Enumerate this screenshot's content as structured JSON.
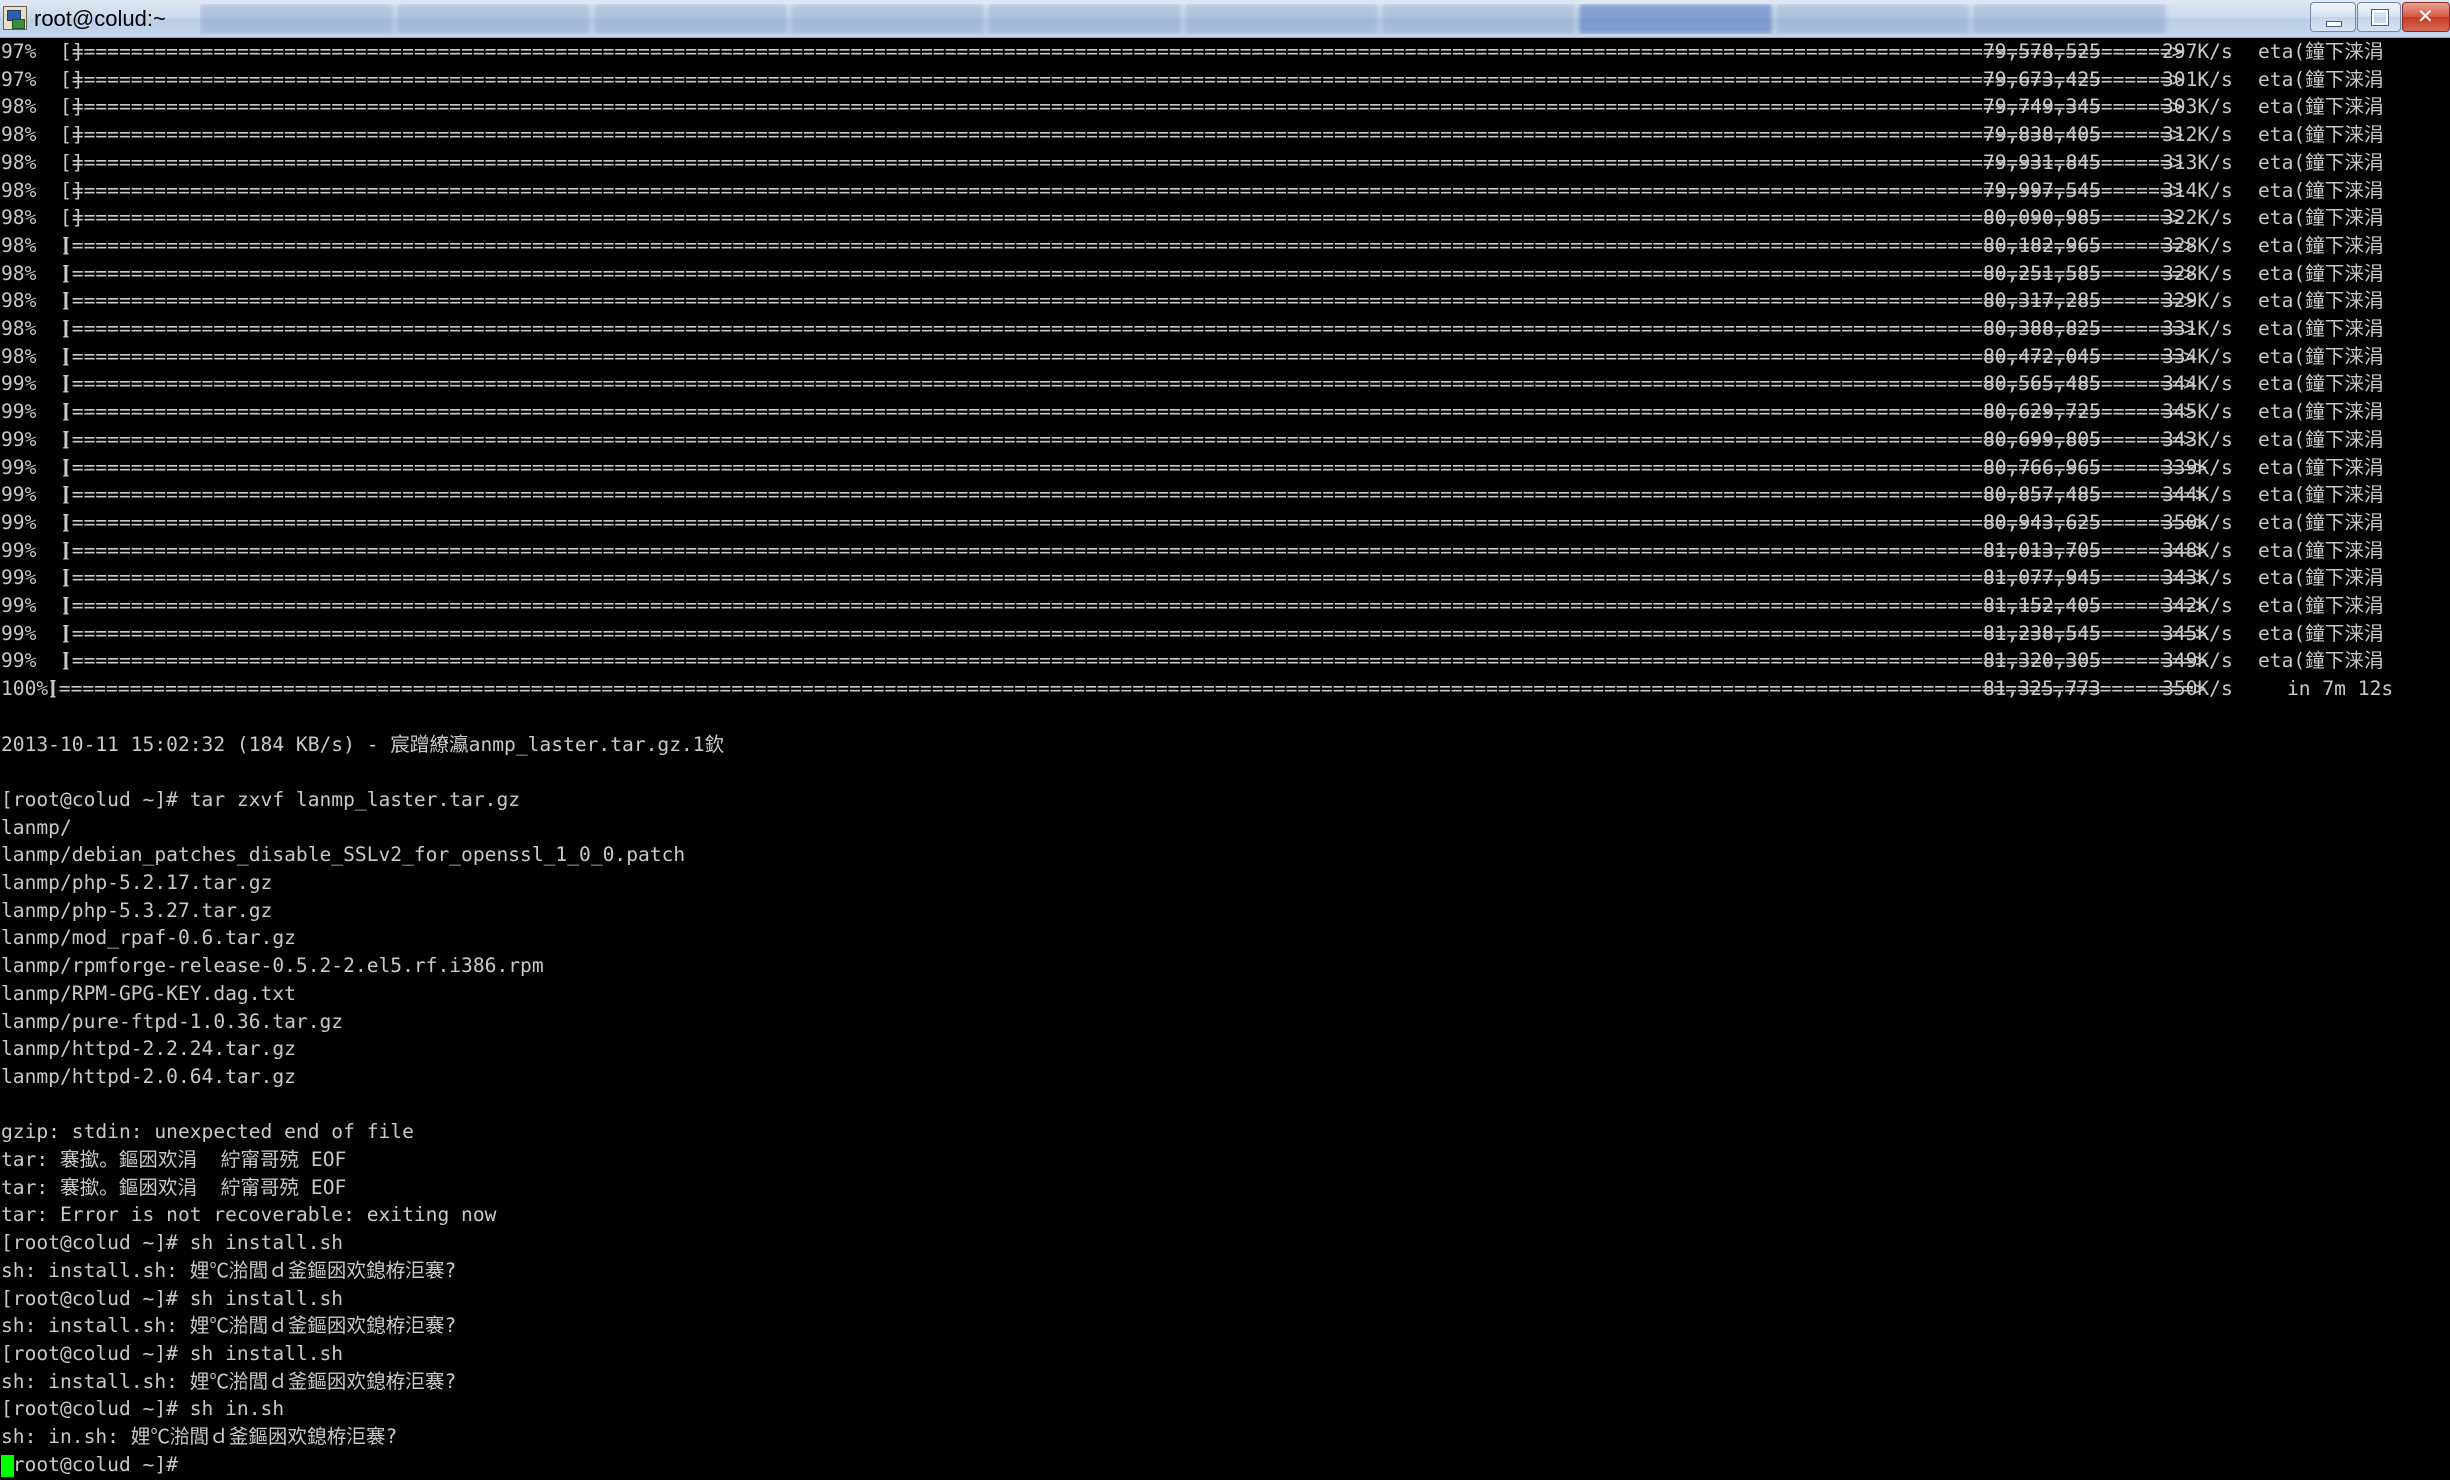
{
  "window": {
    "title": "root@colud:~",
    "icon": "putty-terminal-icon",
    "buttons": [
      "minimize",
      "maximize",
      "close"
    ]
  },
  "colors": {
    "background": "#000000",
    "text": "#c9c9c9",
    "cursor": "#00ff00",
    "titlebar": "#c9d9ec"
  },
  "terminal": {
    "progress_rows": [
      {
        "pct": "97%",
        "bar": "[==================================================================================================================================================================================>",
        "close": " ]",
        "bytes": "79,578,525",
        "speed": "297K/s",
        "eta": "eta(鐘下涞涓"
      },
      {
        "pct": "97%",
        "bar": "[==================================================================================================================================================================================>",
        "close": " ]",
        "bytes": "79,673,425",
        "speed": "301K/s",
        "eta": "eta(鐘下涞涓"
      },
      {
        "pct": "98%",
        "bar": "[==================================================================================================================================================================================>",
        "close": " ]",
        "bytes": "79,749,345",
        "speed": "303K/s",
        "eta": "eta(鐘下涞涓"
      },
      {
        "pct": "98%",
        "bar": "[==================================================================================================================================================================================>",
        "close": " ]",
        "bytes": "79,838,405",
        "speed": "312K/s",
        "eta": "eta(鐘下涞涓"
      },
      {
        "pct": "98%",
        "bar": "[==================================================================================================================================================================================>",
        "close": " ]",
        "bytes": "79,931,845",
        "speed": "313K/s",
        "eta": "eta(鐘下涞涓"
      },
      {
        "pct": "98%",
        "bar": "[==================================================================================================================================================================================>",
        "close": " ]",
        "bytes": "79,997,545",
        "speed": "314K/s",
        "eta": "eta(鐘下涞涓"
      },
      {
        "pct": "98%",
        "bar": "[==================================================================================================================================================================================>",
        "close": " ]",
        "bytes": "80,090,985",
        "speed": "322K/s",
        "eta": "eta(鐘下涞涓"
      },
      {
        "pct": "98%",
        "bar": "[===================================================================================================================================================================================>",
        "close": "]",
        "bytes": "80,182,965",
        "speed": "328K/s",
        "eta": "eta(鐘下涞涓"
      },
      {
        "pct": "98%",
        "bar": "[===================================================================================================================================================================================>",
        "close": "]",
        "bytes": "80,251,585",
        "speed": "328K/s",
        "eta": "eta(鐘下涞涓"
      },
      {
        "pct": "98%",
        "bar": "[===================================================================================================================================================================================>",
        "close": "]",
        "bytes": "80,317,285",
        "speed": "329K/s",
        "eta": "eta(鐘下涞涓"
      },
      {
        "pct": "98%",
        "bar": "[===================================================================================================================================================================================>",
        "close": "]",
        "bytes": "80,388,825",
        "speed": "331K/s",
        "eta": "eta(鐘下涞涓"
      },
      {
        "pct": "98%",
        "bar": "[===================================================================================================================================================================================>",
        "close": "]",
        "bytes": "80,472,045",
        "speed": "334K/s",
        "eta": "eta(鐘下涞涓"
      },
      {
        "pct": "99%",
        "bar": "[===================================================================================================================================================================================>",
        "close": "]",
        "bytes": "80,565,485",
        "speed": "344K/s",
        "eta": "eta(鐘下涞涓"
      },
      {
        "pct": "99%",
        "bar": "[===================================================================================================================================================================================>",
        "close": "]",
        "bytes": "80,629,725",
        "speed": "345K/s",
        "eta": "eta(鐘下涞涓"
      },
      {
        "pct": "99%",
        "bar": "[===================================================================================================================================================================================>",
        "close": "]",
        "bytes": "80,699,805",
        "speed": "343K/s",
        "eta": "eta(鐘下涞涓"
      },
      {
        "pct": "99%",
        "bar": "[====================================================================================================================================================================================>",
        "close": "]",
        "bytes": "80,766,965",
        "speed": "339K/s",
        "eta": "eta(鐘下涞涓"
      },
      {
        "pct": "99%",
        "bar": "[====================================================================================================================================================================================>",
        "close": "]",
        "bytes": "80,857,485",
        "speed": "344K/s",
        "eta": "eta(鐘下涞涓"
      },
      {
        "pct": "99%",
        "bar": "[====================================================================================================================================================================================>",
        "close": "]",
        "bytes": "80,943,625",
        "speed": "350K/s",
        "eta": "eta(鐘下涞涓"
      },
      {
        "pct": "99%",
        "bar": "[====================================================================================================================================================================================>",
        "close": "]",
        "bytes": "81,013,705",
        "speed": "348K/s",
        "eta": "eta(鐘下涞涓"
      },
      {
        "pct": "99%",
        "bar": "[====================================================================================================================================================================================>",
        "close": "]",
        "bytes": "81,077,945",
        "speed": "343K/s",
        "eta": "eta(鐘下涞涓"
      },
      {
        "pct": "99%",
        "bar": "[====================================================================================================================================================================================>",
        "close": "]",
        "bytes": "81,152,405",
        "speed": "342K/s",
        "eta": "eta(鐘下涞涓"
      },
      {
        "pct": "99%",
        "bar": "[====================================================================================================================================================================================>",
        "close": "]",
        "bytes": "81,238,545",
        "speed": "345K/s",
        "eta": "eta(鐘下涞涓"
      },
      {
        "pct": "99%",
        "bar": "[====================================================================================================================================================================================>",
        "close": "]",
        "bytes": "81,320,305",
        "speed": "349K/s",
        "eta": "eta(鐘下涞涓"
      },
      {
        "pct": "100%",
        "bar": "[=====================================================================================================================================================================================>",
        "close": "]",
        "bytes": "81,325,773",
        "speed": "350K/s",
        "eta": "in 7m 12s"
      }
    ],
    "lines": [
      "",
      "2013-10-11 15:02:32 (184 KB/s) - 宸蹭繚瀛anmp_laster.tar.gz.1欽",
      "",
      "[root@colud ~]# tar zxvf lanmp_laster.tar.gz",
      "lanmp/",
      "lanmp/debian_patches_disable_SSLv2_for_openssl_1_0_0.patch",
      "lanmp/php-5.2.17.tar.gz",
      "lanmp/php-5.3.27.tar.gz",
      "lanmp/mod_rpaf-0.6.tar.gz",
      "lanmp/rpmforge-release-0.5.2-2.el5.rf.i386.rpm",
      "lanmp/RPM-GPG-KEY.dag.txt",
      "lanmp/pure-ftpd-1.0.36.tar.gz",
      "lanmp/httpd-2.2.24.tar.gz",
      "lanmp/httpd-2.0.64.tar.gz",
      "",
      "gzip: stdin: unexpected end of file",
      "tar: 褰撳。鏂囦欢涓  紵甯哥殑 EOF",
      "tar: 褰撳。鏂囦欢涓  紵甯哥殑 EOF",
      "tar: Error is not recoverable: exiting now",
      "[root@colud ~]# sh install.sh",
      "sh: install.sh: 娌℃湁閭ｄ釜鏂囦欢鎴栫洰褰?",
      "[root@colud ~]# sh install.sh",
      "sh: install.sh: 娌℃湁閭ｄ釜鏂囦欢鎴栫洰褰?",
      "[root@colud ~]# sh install.sh",
      "sh: install.sh: 娌℃湁閭ｄ釜鏂囦欢鎴栫洰褰?",
      "[root@colud ~]# sh in.sh",
      "sh: in.sh: 娌℃湁閭ｄ釜鏂囦欢鎴栫洰褰?",
      "[root@colud ~]# "
    ]
  }
}
